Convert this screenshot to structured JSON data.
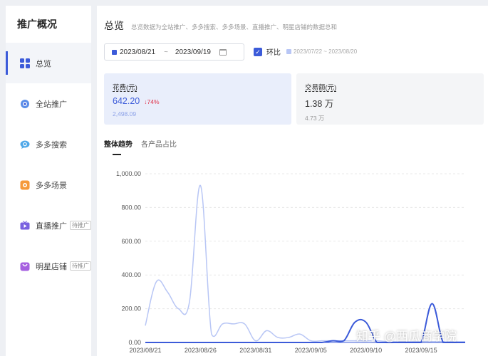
{
  "sidebar": {
    "title": "推广概况",
    "items": [
      {
        "label": "总览",
        "icon": "grid-icon",
        "active": true
      },
      {
        "label": "全站推广",
        "icon": "globe-promo-icon",
        "badge": ""
      },
      {
        "label": "多多搜索",
        "icon": "search-chat-icon",
        "badge": ""
      },
      {
        "label": "多多场景",
        "icon": "scene-icon",
        "badge": ""
      },
      {
        "label": "直播推广",
        "icon": "live-tv-icon",
        "badge": "待推广"
      },
      {
        "label": "明星店铺",
        "icon": "star-shop-icon",
        "badge": "待推广"
      }
    ]
  },
  "header": {
    "title": "总览",
    "description": "总览数据为全站推广、多多搜索、多多场景、直播推广、明星店铺的数据总和"
  },
  "date_range": {
    "start": "2023/08/21",
    "separator": "~",
    "end": "2023/09/19"
  },
  "compare": {
    "label": "环比",
    "checked": true,
    "range": "2023/07/22 ~ 2023/08/20"
  },
  "cards": [
    {
      "label": "花费(元)",
      "value": "642.20",
      "change": "74%",
      "previous": "2,498.09"
    },
    {
      "label": "交易额(元)",
      "value": "1.38 万",
      "change": "",
      "previous": "4.73 万"
    }
  ],
  "tabs": [
    {
      "label": "整体趋势",
      "active": true
    },
    {
      "label": "各产品占比",
      "active": false
    }
  ],
  "colors": {
    "accent": "#3c5bd9",
    "compare": "#b8c6f5",
    "negative": "#e0334a"
  },
  "chart_data": {
    "type": "line",
    "x": [
      "2023/08/21",
      "2023/08/22",
      "2023/08/23",
      "2023/08/24",
      "2023/08/25",
      "2023/08/26",
      "2023/08/27",
      "2023/08/28",
      "2023/08/29",
      "2023/08/30",
      "2023/08/31",
      "2023/09/01",
      "2023/09/02",
      "2023/09/03",
      "2023/09/04",
      "2023/09/05",
      "2023/09/06",
      "2023/09/07",
      "2023/09/08",
      "2023/09/09",
      "2023/09/10",
      "2023/09/11",
      "2023/09/12",
      "2023/09/13",
      "2023/09/14",
      "2023/09/15",
      "2023/09/16",
      "2023/09/17",
      "2023/09/18",
      "2023/09/19"
    ],
    "x_tick_labels": [
      "2023/08/21",
      "2023/08/26",
      "2023/08/31",
      "2023/09/05",
      "2023/09/10",
      "2023/09/15"
    ],
    "y_tick_labels": [
      "0.00",
      "200.00",
      "400.00",
      "600.00",
      "800.00",
      "1,000.00"
    ],
    "ylim": [
      0,
      1000
    ],
    "grid": true,
    "series": [
      {
        "values": [
          100,
          360,
          300,
          200,
          240,
          930,
          50,
          110,
          110,
          110,
          10,
          70,
          30,
          30,
          50,
          10,
          10,
          10,
          10,
          10,
          10,
          10,
          5,
          5,
          5,
          5,
          5,
          5,
          5,
          5
        ]
      },
      {
        "values": [
          0,
          0,
          0,
          0,
          0,
          0,
          0,
          0,
          0,
          0,
          0,
          0,
          0,
          0,
          0,
          0,
          0,
          10,
          10,
          120,
          120,
          0,
          0,
          0,
          0,
          0,
          230,
          0,
          0,
          0
        ]
      }
    ]
  },
  "watermark": "知乎 @西瓜商学院"
}
